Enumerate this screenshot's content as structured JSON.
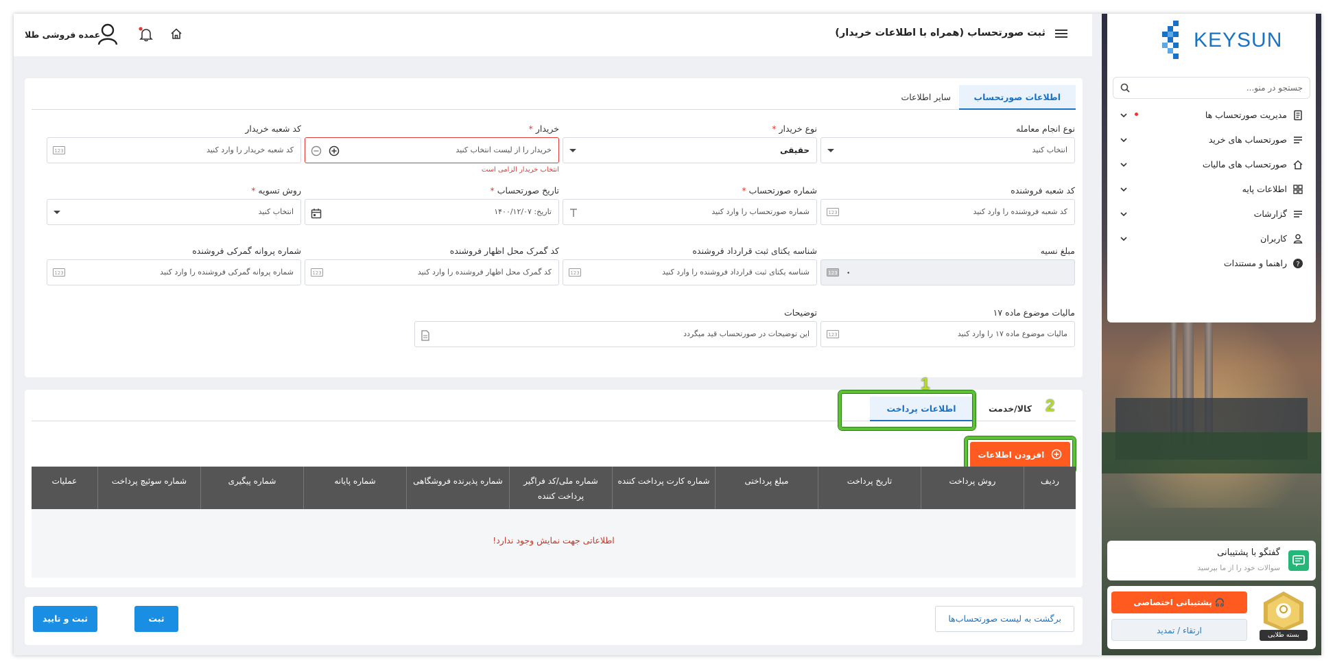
{
  "header": {
    "title": "ثبت صورتحساب (همراه با اطلاعات خریدار)",
    "user_name": "عمده فروشی طلا"
  },
  "sidebar": {
    "logo_text": "KEYSUN",
    "search_placeholder": "جستجو در منو...",
    "items": [
      {
        "label": "مدیریت صورتحساب ها",
        "icon": "invoice-icon",
        "has_dot": true
      },
      {
        "label": "صورتحساب های خرید",
        "icon": "list-icon"
      },
      {
        "label": "صورتحساب های مالیات",
        "icon": "home-icon"
      },
      {
        "label": "اطلاعات پایه",
        "icon": "grid-icon"
      },
      {
        "label": "گزارشات",
        "icon": "list-icon"
      },
      {
        "label": "کاربران",
        "icon": "user-icon"
      },
      {
        "label": "راهنما و مستندات",
        "icon": "help-icon"
      }
    ],
    "support_title": "گفتگو با پشتیبانی",
    "support_subtitle": "سوالات خود را از ما بپرسید",
    "private_support": "پشتیبانی اختصاصی",
    "upgrade": "ارتقاء / تمدید",
    "plan_label": "بسته طلایی"
  },
  "tabs": {
    "invoice_info": "اطلاعات صورتحساب",
    "other_info": "سایر اطلاعات"
  },
  "fields": {
    "transaction_type": {
      "label": "نوع انجام معامله",
      "value": "انتخاب کنید"
    },
    "buyer_type": {
      "label": "نوع خریدار",
      "value": "حقیقی"
    },
    "buyer": {
      "label": "خریدار",
      "value": "خریدار را از لیست انتخاب کنید",
      "error": "انتخاب خریدار الزامی است"
    },
    "buyer_branch": {
      "label": "کد شعبه خریدار",
      "placeholder": "کد شعبه خریدار را وارد کنید"
    },
    "seller_branch": {
      "label": "کد شعبه فروشنده",
      "placeholder": "کد شعبه فروشنده را وارد کنید"
    },
    "invoice_number": {
      "label": "شماره صورتحساب",
      "placeholder": "شماره صورتحساب را وارد کنید"
    },
    "invoice_date": {
      "label": "تاریخ صورتحساب",
      "value": "تاریخ: ۱۴۰۰/۱۲/۰۷"
    },
    "settlement": {
      "label": "روش تسویه",
      "value": "انتخاب کنید"
    },
    "credit_amount": {
      "label": "مبلغ نسیه",
      "value": "۰"
    },
    "contract_id": {
      "label": "شناسه یکتای ثبت قرارداد فروشنده",
      "placeholder": "شناسه یکتای ثبت قرارداد فروشنده را وارد کنید"
    },
    "customs_code": {
      "label": "کد گمرک محل اظهار فروشنده",
      "placeholder": "کد گمرک محل اظهار فروشنده را وارد کنید"
    },
    "customs_license": {
      "label": "شماره پروانه گمرکی فروشنده",
      "placeholder": "شماره پروانه گمرکی فروشنده را وارد کنید"
    },
    "tax17": {
      "label": "مالیات موضوع ماده ۱۷",
      "placeholder": "مالیات موضوع ماده ۱۷ را وارد کنید"
    },
    "description": {
      "label": "توضیحات",
      "placeholder": "این توضیحات در صورتحساب قید میگردد"
    }
  },
  "lower": {
    "tab_payment": "اطلاعات پرداخت",
    "tab_goods": "کالا/خدمت",
    "add_button": "افزودن اطلاعات پرداخت",
    "marker1": "1",
    "marker2": "2",
    "columns": [
      "ردیف",
      "روش پرداخت",
      "تاریخ پرداخت",
      "مبلغ پرداختی",
      "شماره کارت پرداخت کننده",
      "شماره ملی/کد فراگیر پرداخت کننده",
      "شماره پذیرنده فروشگاهی",
      "شماره پایانه",
      "شماره پیگیری",
      "شماره سوئیچ پرداخت",
      "عملیات"
    ],
    "empty_message": "اطلاعاتی جهت نمایش وجود ندارد!"
  },
  "footer": {
    "back": "برگشت به لیست صورتحساب‌ها",
    "save": "ثبت",
    "save_confirm": "ثبت و تایید"
  },
  "colors": {
    "accent": "#1a8ee3",
    "orange": "#ff5a1f",
    "error": "#e53935",
    "highlight": "#5bc236"
  }
}
